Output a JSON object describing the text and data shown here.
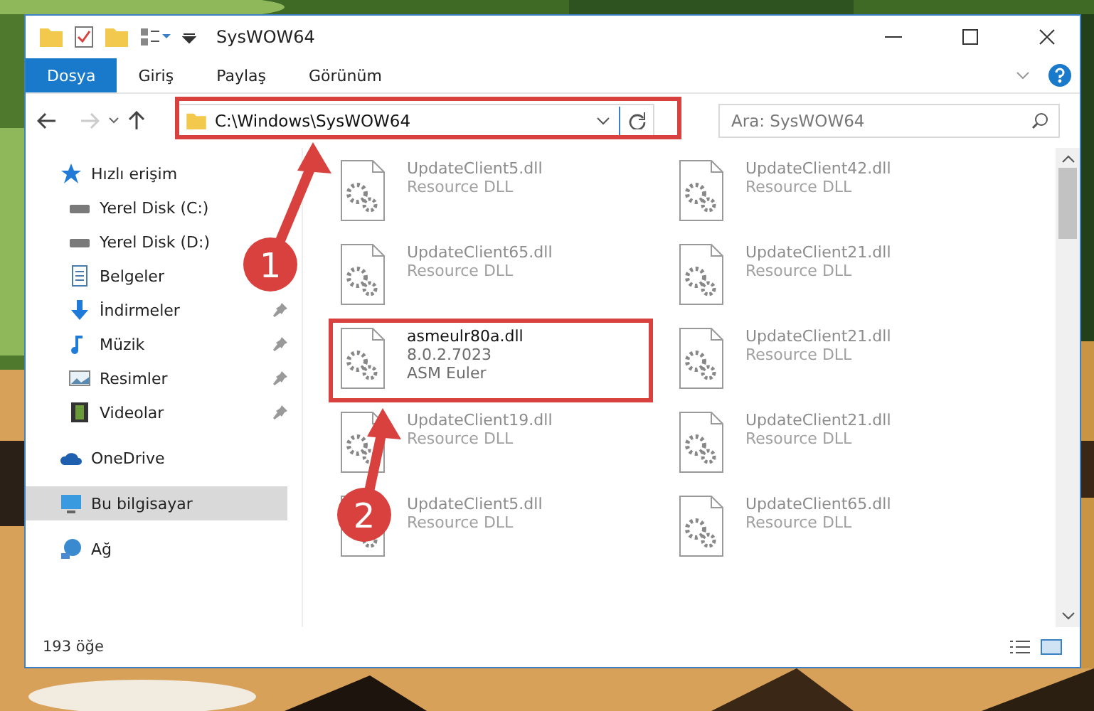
{
  "window": {
    "title": "SysWOW64"
  },
  "ribbon_tabs": [
    {
      "label": "Dosya",
      "selected": true
    },
    {
      "label": "Giriş",
      "selected": false
    },
    {
      "label": "Paylaş",
      "selected": false
    },
    {
      "label": "Görünüm",
      "selected": false
    }
  ],
  "address": {
    "path": "C:\\Windows\\SysWOW64"
  },
  "search": {
    "placeholder": "Ara: SysWOW64"
  },
  "sidebar": {
    "items": [
      {
        "label": "Hızlı erişim",
        "kind": "quick",
        "pinned": false,
        "selected": false,
        "children": [
          {
            "label": "Yerel Disk (C:)",
            "kind": "drive",
            "pinned": false,
            "selected": false
          },
          {
            "label": "Yerel Disk (D:)",
            "kind": "drive",
            "pinned": false,
            "selected": false
          },
          {
            "label": "Belgeler",
            "kind": "docs",
            "pinned": false,
            "selected": false
          },
          {
            "label": "İndirmeler",
            "kind": "downloads",
            "pinned": true,
            "selected": false
          },
          {
            "label": "Müzik",
            "kind": "music",
            "pinned": true,
            "selected": false
          },
          {
            "label": "Resimler",
            "kind": "pictures",
            "pinned": true,
            "selected": false
          },
          {
            "label": "Videolar",
            "kind": "videos",
            "pinned": true,
            "selected": false
          }
        ]
      },
      {
        "label": "OneDrive",
        "kind": "cloud",
        "pinned": false,
        "selected": false
      },
      {
        "label": "Bu bilgisayar",
        "kind": "pc",
        "pinned": false,
        "selected": true
      },
      {
        "label": "Ağ",
        "kind": "network",
        "pinned": false,
        "selected": false
      }
    ]
  },
  "files": [
    {
      "name": "UpdateClient5.dll",
      "lines": [
        "Resource DLL"
      ],
      "dimmed": true,
      "outlined": false
    },
    {
      "name": "UpdateClient42.dll",
      "lines": [
        "Resource DLL"
      ],
      "dimmed": true,
      "outlined": false
    },
    {
      "name": "UpdateClient65.dll",
      "lines": [
        "Resource DLL"
      ],
      "dimmed": true,
      "outlined": false
    },
    {
      "name": "UpdateClient21.dll",
      "lines": [
        "Resource DLL"
      ],
      "dimmed": true,
      "outlined": false
    },
    {
      "name": "asmeulr80a.dll",
      "lines": [
        "8.0.2.7023",
        "ASM Euler"
      ],
      "dimmed": false,
      "outlined": true
    },
    {
      "name": "UpdateClient21.dll",
      "lines": [
        "Resource DLL"
      ],
      "dimmed": true,
      "outlined": false
    },
    {
      "name": "UpdateClient19.dll",
      "lines": [
        "Resource DLL"
      ],
      "dimmed": true,
      "outlined": false
    },
    {
      "name": "UpdateClient21.dll",
      "lines": [
        "Resource DLL"
      ],
      "dimmed": true,
      "outlined": false
    },
    {
      "name": "UpdateClient5.dll",
      "lines": [
        "Resource DLL"
      ],
      "dimmed": true,
      "outlined": false
    },
    {
      "name": "UpdateClient65.dll",
      "lines": [
        "Resource DLL"
      ],
      "dimmed": true,
      "outlined": false
    }
  ],
  "status_bar": {
    "count": "193 öğe"
  },
  "annotations": [
    {
      "number": "1"
    },
    {
      "number": "2"
    }
  ]
}
